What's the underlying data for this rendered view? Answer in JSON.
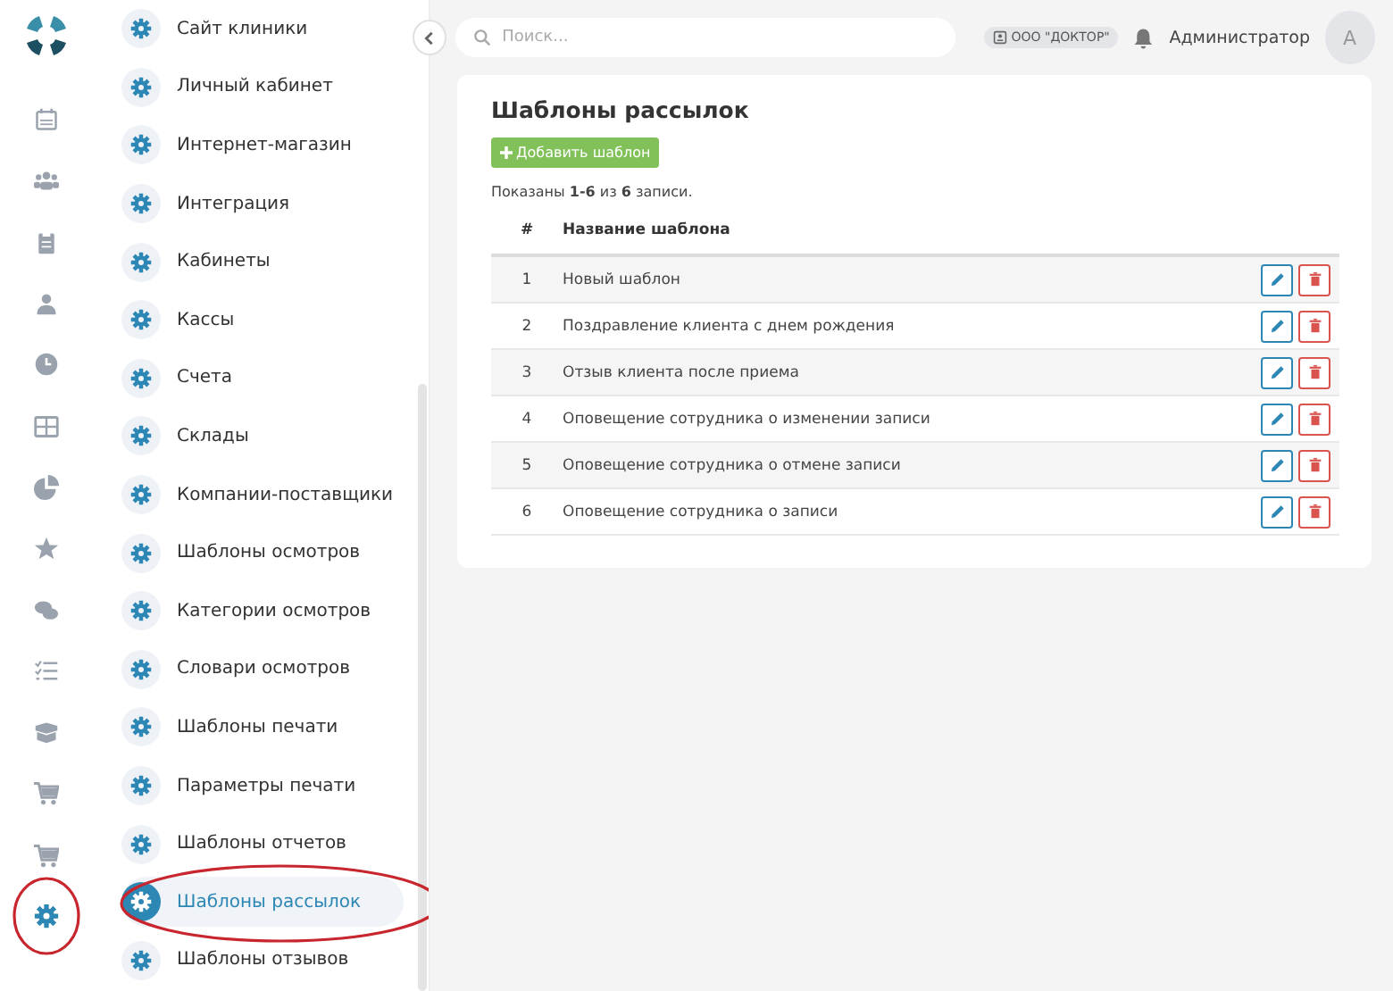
{
  "rail": [
    {
      "selected": false,
      "circled": false
    },
    {
      "selected": false,
      "circled": false
    },
    {
      "selected": false,
      "circled": false
    },
    {
      "selected": false,
      "circled": false
    },
    {
      "selected": false,
      "circled": false
    },
    {
      "selected": false,
      "circled": false
    },
    {
      "selected": false,
      "circled": false
    },
    {
      "selected": false,
      "circled": false
    },
    {
      "selected": false,
      "circled": false
    },
    {
      "selected": false,
      "circled": false
    },
    {
      "selected": false,
      "circled": false
    },
    {
      "selected": false,
      "circled": false
    },
    {
      "selected": false,
      "circled": false
    },
    {
      "selected": true,
      "circled": true
    }
  ],
  "submenu": [
    {
      "label": "Сайт клиники",
      "selected": false,
      "circled": false
    },
    {
      "label": "Личный кабинет",
      "selected": false,
      "circled": false
    },
    {
      "label": "Интернет-магазин",
      "selected": false,
      "circled": false
    },
    {
      "label": "Интеграция",
      "selected": false,
      "circled": false
    },
    {
      "label": "Кабинеты",
      "selected": false,
      "circled": false
    },
    {
      "label": "Кассы",
      "selected": false,
      "circled": false
    },
    {
      "label": "Счета",
      "selected": false,
      "circled": false
    },
    {
      "label": "Склады",
      "selected": false,
      "circled": false
    },
    {
      "label": "Компании-поставщики",
      "selected": false,
      "circled": false
    },
    {
      "label": "Шаблоны осмотров",
      "selected": false,
      "circled": false
    },
    {
      "label": "Категории осмотров",
      "selected": false,
      "circled": false
    },
    {
      "label": "Словари осмотров",
      "selected": false,
      "circled": false
    },
    {
      "label": "Шаблоны печати",
      "selected": false,
      "circled": false
    },
    {
      "label": "Параметры печати",
      "selected": false,
      "circled": false
    },
    {
      "label": "Шаблоны отчетов",
      "selected": false,
      "circled": false
    },
    {
      "label": "Шаблоны рассылок",
      "selected": true,
      "circled": true
    },
    {
      "label": "Шаблоны отзывов",
      "selected": false,
      "circled": false
    }
  ],
  "topbar": {
    "search": {
      "placeholder": "Поиск..."
    },
    "company": "ООО \"ДОКТОР\"",
    "user": "Администратор",
    "avatar": "А"
  },
  "card": {
    "title": "Шаблоны рассылок",
    "add_button": "Добавить шаблон",
    "summary": "Показаны **1-6** из **6** записи.",
    "table": {
      "columns": [
        "#",
        "Название шаблона"
      ],
      "rows": [
        {
          "num": "1",
          "name": "Новый шаблон"
        },
        {
          "num": "2",
          "name": "Поздравление клиента с днем рождения"
        },
        {
          "num": "3",
          "name": "Отзыв клиента после приема"
        },
        {
          "num": "4",
          "name": "Оповещение сотрудника о изменении записи"
        },
        {
          "num": "5",
          "name": "Оповещение сотрудника о отмене записи"
        },
        {
          "num": "6",
          "name": "Оповещение сотрудника о записи"
        }
      ]
    }
  }
}
